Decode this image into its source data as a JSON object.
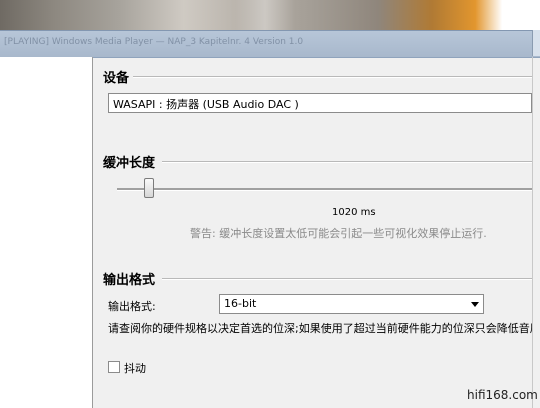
{
  "window": {
    "title": "[PLAYING] Windows Media Player — NAP_3 Kapitelnr. 4 Version 1.0"
  },
  "device_section": {
    "title": "设备",
    "device_select": {
      "value": "WASAPI : 扬声器 (USB Audio DAC   )"
    }
  },
  "buffer_section": {
    "title": "缓冲长度",
    "slider": {
      "value_ms": 1020,
      "value_label": "1020 ms"
    },
    "warning": "警告: 缓冲长度设置太低可能会引起一些可视化效果停止运行."
  },
  "output_section": {
    "title": "输出格式",
    "format_label": "输出格式:",
    "format_select": {
      "value": "16-bit"
    },
    "hint": "请查阅你的硬件规格以决定首选的位深;如果使用了超过当前硬件能力的位深只会降低音质。",
    "dither_checkbox": {
      "label": "抖动",
      "checked": false
    }
  },
  "watermark": "hifi168.com"
}
